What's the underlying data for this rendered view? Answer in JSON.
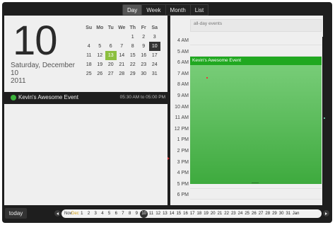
{
  "views": [
    "Day",
    "Week",
    "Month",
    "List"
  ],
  "active_view": "Day",
  "day_panel": {
    "day_number": "10",
    "date_line1": "Saturday, December",
    "date_line2": "10",
    "date_line3": "2011"
  },
  "mini_calendar": {
    "headers": [
      "Su",
      "Mo",
      "Tu",
      "We",
      "Th",
      "Fr",
      "Sa"
    ],
    "weeks": [
      [
        "",
        "",
        "",
        "",
        "1",
        "2",
        "3"
      ],
      [
        "4",
        "5",
        "6",
        "7",
        "8",
        "9",
        "10"
      ],
      [
        "11",
        "12",
        "13",
        "14",
        "15",
        "16",
        "17"
      ],
      [
        "18",
        "19",
        "20",
        "21",
        "22",
        "23",
        "24"
      ],
      [
        "25",
        "26",
        "27",
        "28",
        "29",
        "30",
        "31"
      ]
    ],
    "selected": "10",
    "highlighted": "13"
  },
  "event_row": {
    "title": "Kevin's Awesome Event",
    "time": "05:30 AM to 05:00 PM"
  },
  "day_view": {
    "allday_label": "all-day events",
    "hours": [
      "4 AM",
      "5 AM",
      "6 AM",
      "7 AM",
      "8 AM",
      "9 AM",
      "10 AM",
      "11 AM",
      "12 PM",
      "1 PM",
      "2 PM",
      "3 PM",
      "4 PM",
      "5 PM",
      "6 PM"
    ],
    "event_title": "Kevin's Awesome Event"
  },
  "bottom": {
    "today_label": "today",
    "months_before": [
      "Nov",
      "Dec"
    ],
    "days": [
      "1",
      "2",
      "3",
      "4",
      "5",
      "6",
      "7",
      "8",
      "9",
      "10",
      "11",
      "12",
      "13",
      "14",
      "15",
      "16",
      "17",
      "18",
      "19",
      "20",
      "21",
      "22",
      "23",
      "24",
      "25",
      "26",
      "27",
      "28",
      "29",
      "30",
      "31"
    ],
    "selected_day": "10",
    "month_after": "Jan"
  },
  "colors": {
    "event_green": "#20a820",
    "today_green": "#8cbf3f",
    "current_month": "#d4a017"
  }
}
